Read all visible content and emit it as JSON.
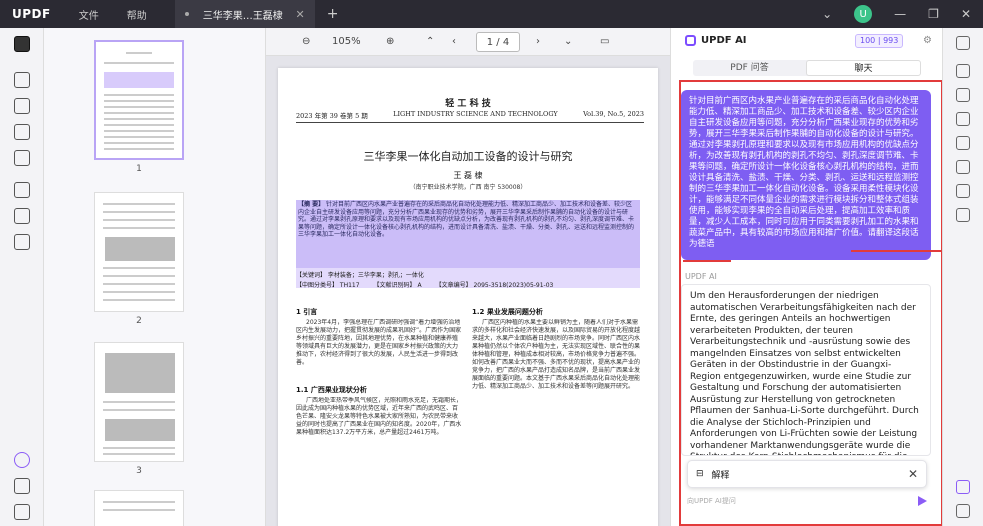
{
  "app": {
    "logo": "UPDF",
    "menus": [
      "文件",
      "帮助"
    ],
    "tab_title": "三华李果…王磊棣",
    "avatar_letter": "U"
  },
  "viewer": {
    "zoom": "105%",
    "page_indicator": "1 / 4"
  },
  "thumbnails": {
    "pages": [
      "1",
      "2",
      "3"
    ]
  },
  "document": {
    "journal": "轻 工 科 技",
    "issue": "2023 年第 39 卷第 5 期",
    "journal_en": "LIGHT INDUSTRY SCIENCE AND TECHNOLOGY",
    "volume": "Vol.39, No.5, 2023",
    "title": "三华李果一体化自动加工设备的设计与研究",
    "author": "王 磊 棣",
    "affiliation": "（南宁职业技术学院，广西 南宁 530008）",
    "abstract_label": "【摘 要】",
    "abstract": "针对目前广西区内水果产业普遍存在的采后商品化自动化处理能力低、精深加工商品少、加工技术和设备差、较少区内企业自主研发设备应用等问题，充分分析广西果业现存的优势和劣势，展开三华李果采后制作果脯的自动化设备的设计与研究。通过对李果剥孔原理和要求以及现有市场应用机构的优缺点分析，为改善现有剥孔机构的剥孔不均匀、剥孔深度调节难、卡果等问题，确定所设计一体化设备核心剥孔机构的结构，进而设计具备清洗、盐渍、干燥、分类、剥孔、运送和远程监测控制的三华李果加工一体化自动化设备。",
    "keywords": "【关键词】 李材装备；三华李果；剥孔；一体化",
    "clc": "【中图分类号】 TH117",
    "doc_code": "【文献识别码】 A",
    "article_no": "【文章编号】 2095-3518(2023)05-91-03",
    "sec1": "1 引言",
    "sec1_text": "2023年4月，李强总理在广西调研时强调“着力增强防治地区内生发展动力，把握贯彻发展的成果巩固好”。广西作为国家乡村振兴的重要阵地，因其地理优势，在水果种植和健康养殖等领域具有巨大的发展潜力，更是在国家乡村振兴政策的大力推动下，农村经济得到了很大的发展，人民生活进一步得到改善。",
    "sec11": "1.1 广西果业现状分析",
    "sec11_text": "广西地处亚热带季风气候区，光照和雨水充足，无霜期长，因此成为国内种植水果的优势区域，近年来广西的武鸣区、百色芒果、隆安火龙果等特色水果被大家所熟知，为农民带来收益的同时也提高了广西果业在国内的知名度。2020年，广西水果种植面积达137.2万平方米，总产量超过2461万吨。",
    "sec12": "1.2 果业发展问题分析",
    "sec12_text": "广西区内种植的水果主要以鲜销为主，随着人们对于水果需求的多样化和社会经济快速发展，以及国际贸易的开放化程度越来越大，水果产业面临着日趋剧烈的市场竞争。同时广西区内水果种植仍然以个体农户种植为主，无法实现区域性、联合性的果体种植和管理，种植成本相对较高，市场价格竞争力普遍不强。如何改善广西果业大而不强、多而不优的现状，提高水果产业的竞争力，把广西的水果产品打造成知名品牌，是当前广西果业发展面临的重要问题。本文基于广西水果采后商品化自动化处理能力低、精深加工商品少、加工技术和设备差等问题展开研究。"
  },
  "ai": {
    "title": "UPDF AI",
    "quota_a": "100",
    "quota_b": "993",
    "tab_pdf": "PDF 问答",
    "tab_chat": "聊天",
    "user_message": "针对目前广西区内水果产业普遍存在的采后商品化自动化处理能力低、精深加工商品少、加工技术和设备差、较少区内企业自主研发设备应用等问题，充分分析广西果业现存的优势和劣势，展开三华李果采后制作果脯的自动化设备的设计与研究。通过对李果剥孔原理和要求以及现有市场应用机构的优缺点分析，为改善现有剥孔机构的剥孔不均匀、剥孔深度调节难、卡果等问题，确定所设计一体化设备核心剥孔机构的结构，进而设计具备清洗、盐渍、干燥、分类、剥孔、运送和远程监测控制的三华李果加工一体化自动化设备。设备采用柔性模块化设计，能够满足不同体量企业的需求进行模块拆分和整体式组装使用，能够实现李果的全自动采后处理，提高加工效率和质量，减少人工成本，同时可应用于同类需要剥孔加工的水果和蔬菜产品中，具有较高的市场应用和推广价值。请翻译这段话为德语",
    "assistant_label": "UPDF AI",
    "answer": "Um den Herausforderungen der niedrigen automatischen Verarbeitungsfähigkeiten nach der Ernte, des geringen Anteils an hochwertigen verarbeiteten Produkten, der teuren Verarbeitungstechnik und -ausrüstung sowie des mangelnden Einsatzes von selbst entwickelten Geräten in der Obstindustrie in der Guangxi-Region entgegenzuwirken, wurde eine Studie zur Gestaltung und Forschung der automatisierten Ausrüstung zur Herstellung von getrockneten Pflaumen der Sanhua-Li-Sorte durchgeführt. Durch die Analyse der Stichloch-Prinzipien und Anforderungen von Li-Früchten sowie der Leistung vorhandener Marktanwendungsgeräte wurde die Struktur des Kern-Stichlochmechanismus für die integrierte Ausrüstungsentwicklung festgelegt. Anschließend wurde",
    "explain_label": "解释",
    "input_hint": "向UPDF AI提问"
  }
}
